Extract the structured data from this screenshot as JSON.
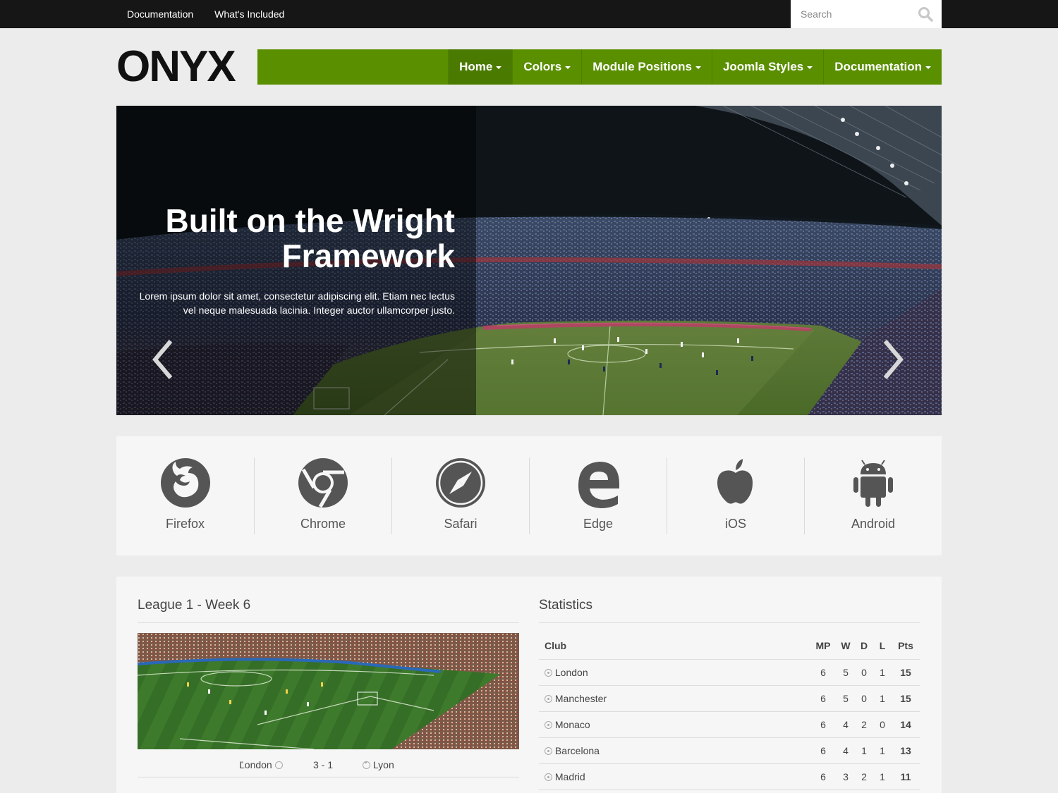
{
  "topbar": {
    "links": [
      "Documentation",
      "What's Included"
    ],
    "search_placeholder": "Search"
  },
  "logo": "ONYX",
  "nav": [
    {
      "label": "Home",
      "active": true
    },
    {
      "label": "Colors",
      "active": false
    },
    {
      "label": "Module Positions",
      "active": false
    },
    {
      "label": "Joomla Styles",
      "active": false
    },
    {
      "label": "Documentation",
      "active": false
    }
  ],
  "hero": {
    "title_line1": "Built on the Wright",
    "title_line2": "Framework",
    "text": "Lorem ipsum dolor sit amet, consectetur adipiscing elit. Etiam nec lectus vel neque malesuada lacinia. Integer auctor ullamcorper justo."
  },
  "browsers": [
    {
      "label": "Firefox",
      "icon": "firefox-icon"
    },
    {
      "label": "Chrome",
      "icon": "chrome-icon"
    },
    {
      "label": "Safari",
      "icon": "safari-icon"
    },
    {
      "label": "Edge",
      "icon": "edge-icon"
    },
    {
      "label": "iOS",
      "icon": "apple-icon"
    },
    {
      "label": "Android",
      "icon": "android-icon"
    }
  ],
  "league": {
    "title": "League 1 - Week 6",
    "match": {
      "home": "London",
      "score": "3 - 1",
      "away": "Lyon"
    }
  },
  "stats": {
    "title": "Statistics",
    "headers": [
      "Club",
      "MP",
      "W",
      "D",
      "L",
      "Pts"
    ],
    "rows": [
      [
        "London",
        "6",
        "5",
        "0",
        "1",
        "15"
      ],
      [
        "Manchester",
        "6",
        "5",
        "0",
        "1",
        "15"
      ],
      [
        "Monaco",
        "6",
        "4",
        "2",
        "0",
        "14"
      ],
      [
        "Barcelona",
        "6",
        "4",
        "1",
        "1",
        "13"
      ],
      [
        "Madrid",
        "6",
        "3",
        "2",
        "1",
        "11"
      ]
    ]
  },
  "colors": {
    "brand_green": "#5a8f00",
    "topbar": "#161616"
  }
}
